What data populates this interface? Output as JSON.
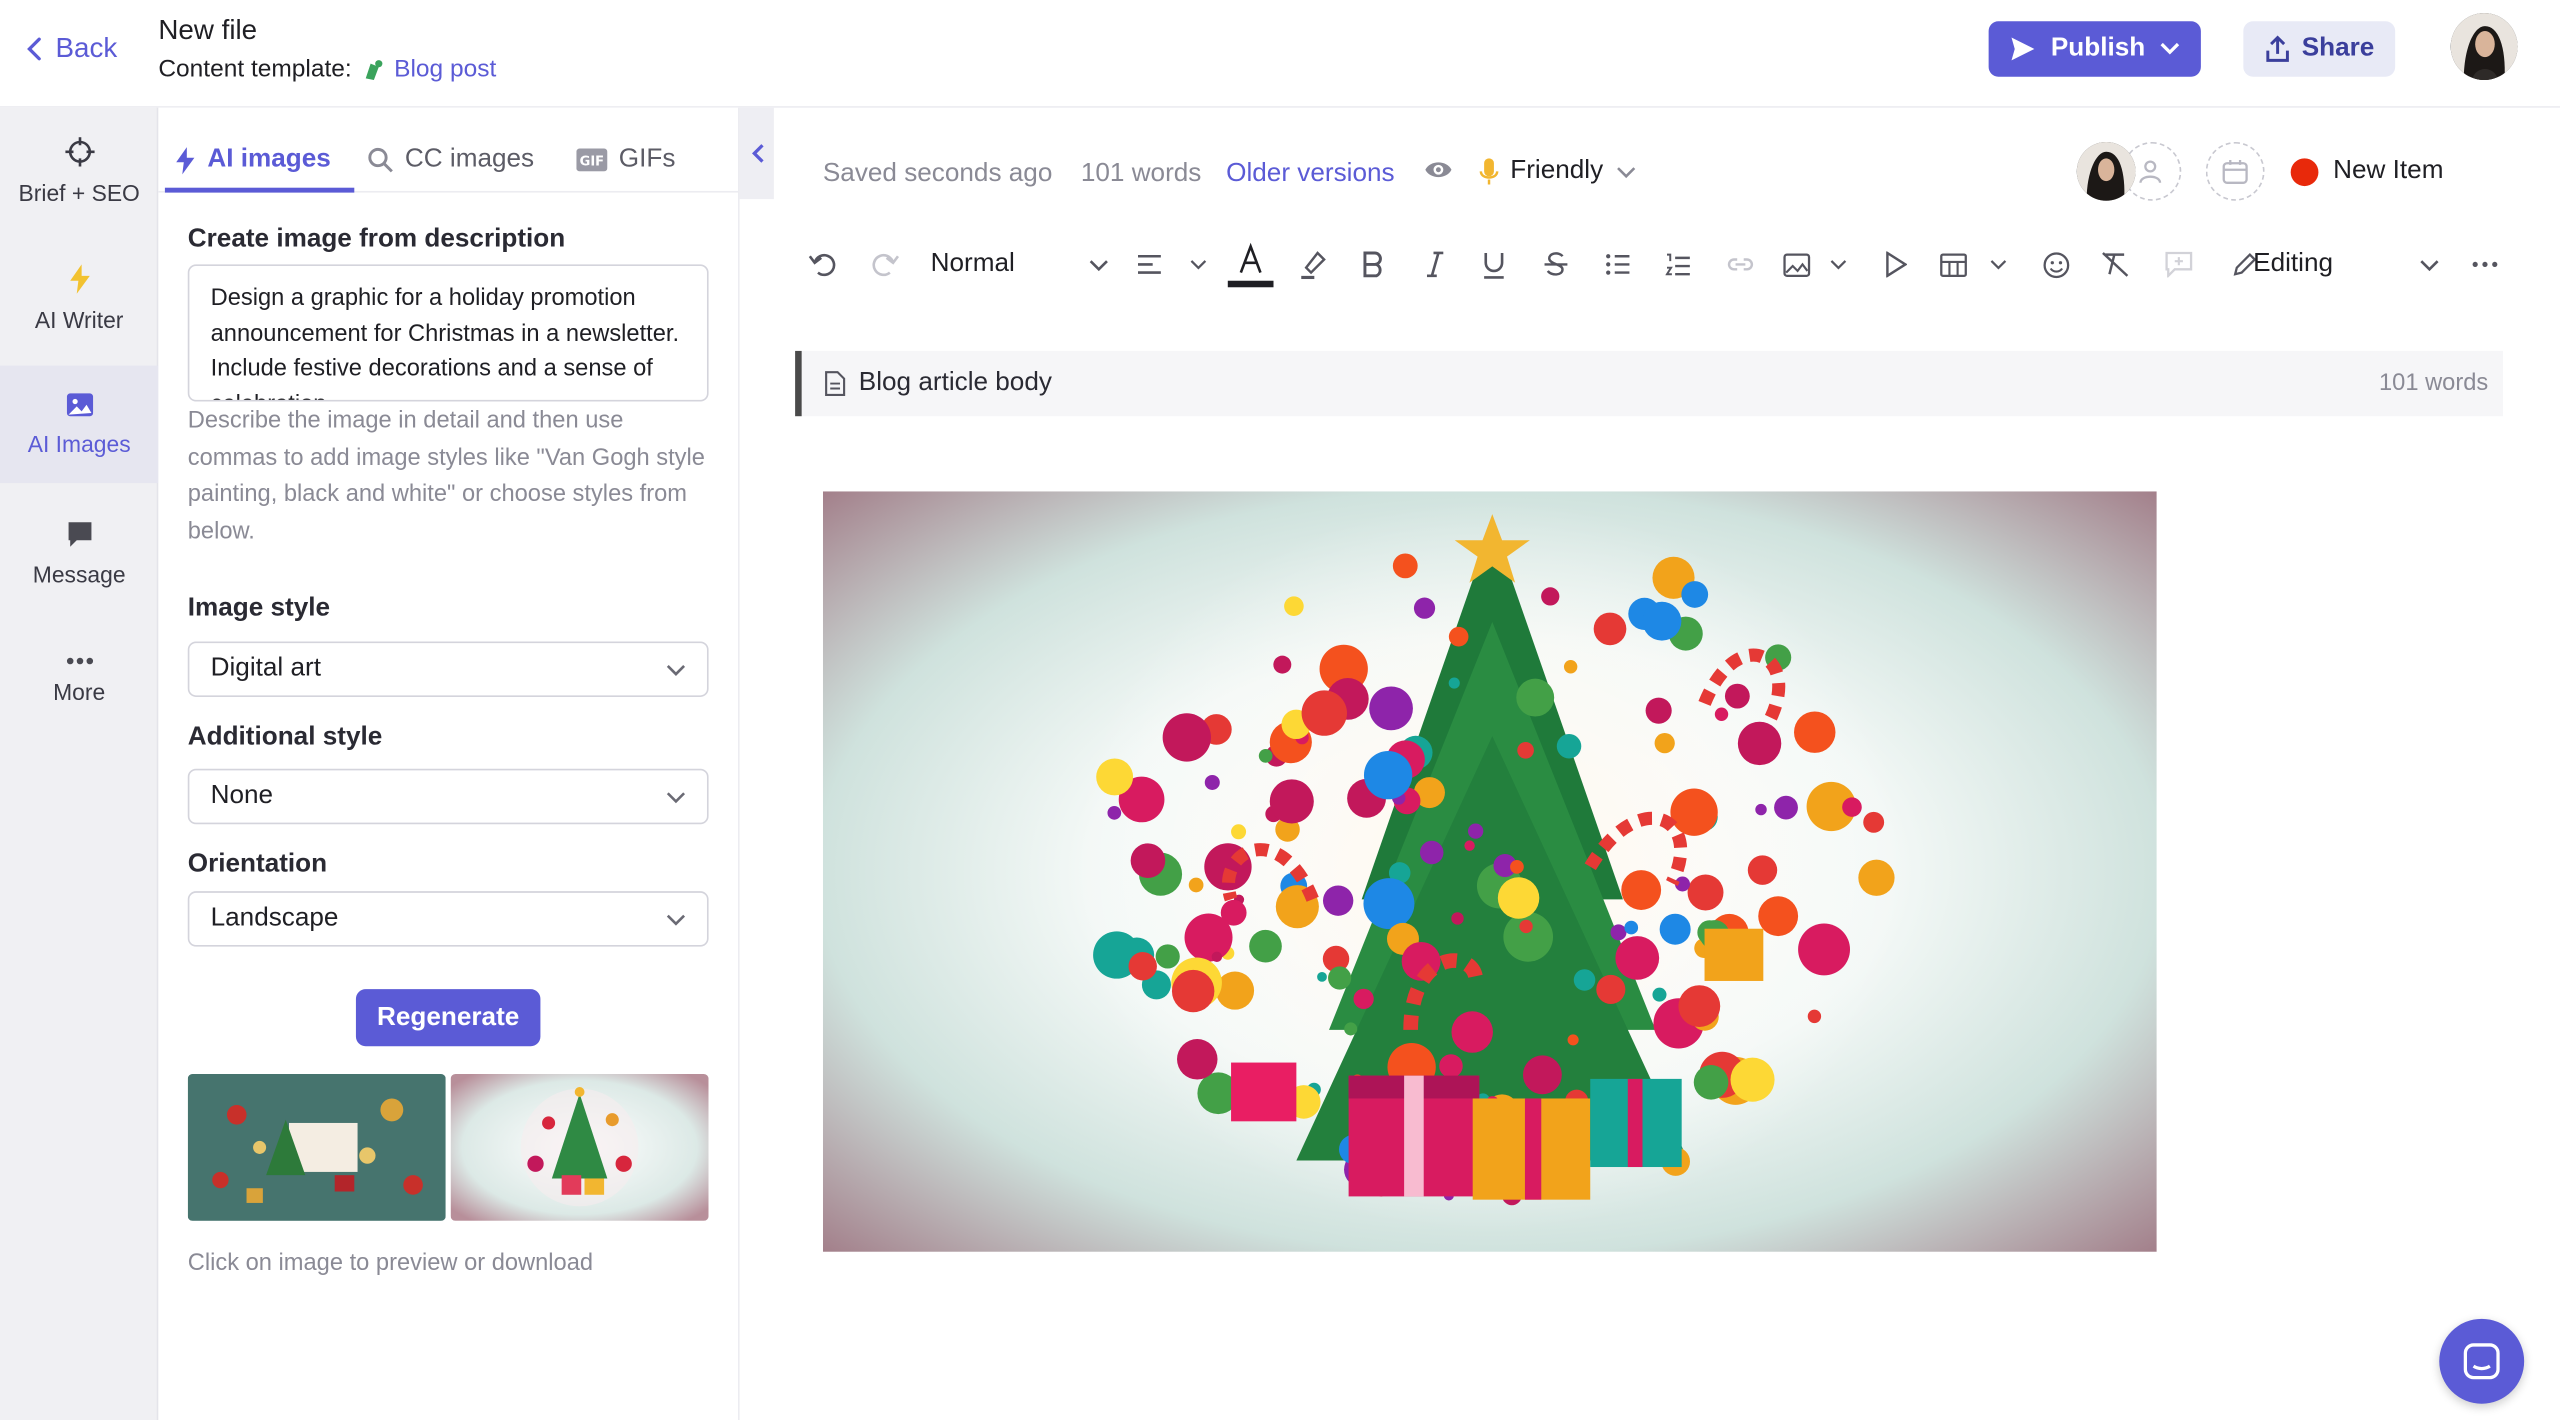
{
  "header": {
    "back_label": "Back",
    "file_title": "New file",
    "template_label": "Content template:",
    "template_name": "Blog post",
    "publish_label": "Publish",
    "share_label": "Share"
  },
  "rail": {
    "items": [
      {
        "label": "Brief + SEO",
        "icon": "crosshair-icon"
      },
      {
        "label": "AI Writer",
        "icon": "lightning-icon"
      },
      {
        "label": "AI Images",
        "icon": "image-icon"
      },
      {
        "label": "Message",
        "icon": "message-icon"
      },
      {
        "label": "More",
        "icon": "more-dots-icon"
      }
    ],
    "active": "AI Images"
  },
  "panel": {
    "tabs": [
      {
        "label": "AI images",
        "icon": "lightning-icon"
      },
      {
        "label": "CC images",
        "icon": "search-icon"
      },
      {
        "label": "GIFs",
        "icon": "gif-icon"
      }
    ],
    "create_label": "Create image from description",
    "description": "Design a graphic for a holiday promotion announcement for Christmas in a newsletter. Include festive decorations and a sense of celebration",
    "hint": "Describe the image in detail and then use commas to add image styles like \"Van Gogh style painting, black and white\" or choose styles from below.",
    "image_style_label": "Image style",
    "image_style_value": "Digital art",
    "additional_style_label": "Additional style",
    "additional_style_value": "None",
    "orientation_label": "Orientation",
    "orientation_value": "Landscape",
    "regenerate_label": "Regenerate",
    "click_hint": "Click on image to preview or download"
  },
  "editor": {
    "saved_text": "Saved seconds ago",
    "word_count": "101 words",
    "older_versions": "Older versions",
    "tone": "Friendly",
    "new_item": "New Item",
    "format_value": "Normal",
    "editing_label": "Editing",
    "block_title": "Blog article body",
    "block_words": "101 words"
  },
  "colors": {
    "accent": "#5b5bd6",
    "new_item_dot": "#e8290b",
    "share_bg": "#e8eaf6"
  }
}
